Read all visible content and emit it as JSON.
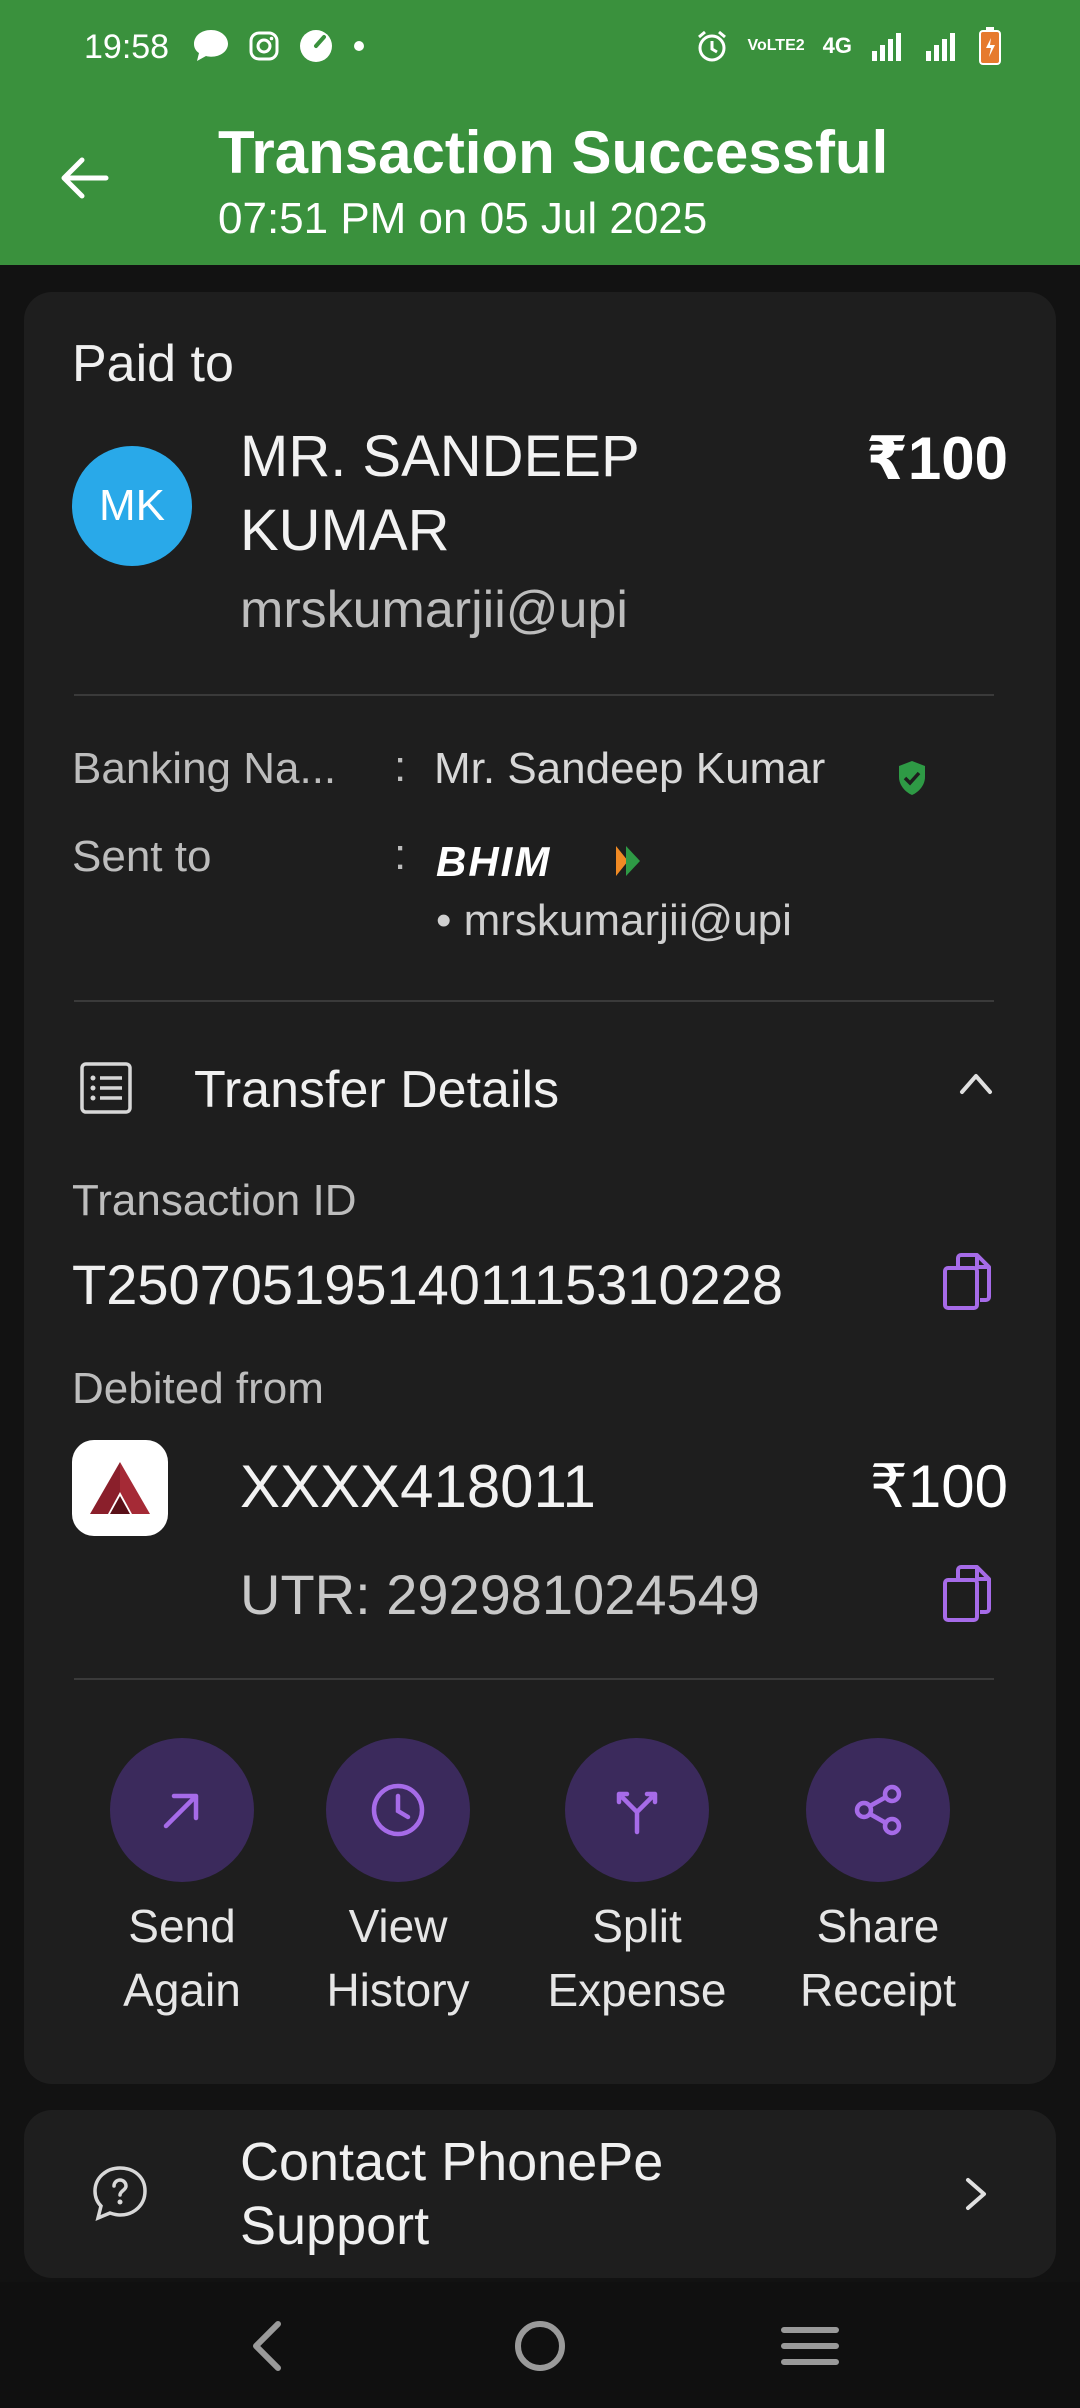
{
  "status_bar": {
    "time": "19:58",
    "network_label": "4G",
    "volte_label": "VoLTE2"
  },
  "header": {
    "title": "Transaction Successful",
    "subtitle": "07:51 PM on 05 Jul 2025"
  },
  "payee": {
    "section_label": "Paid to",
    "avatar_initials": "MK",
    "name": "MR. SANDEEP KUMAR",
    "amount": "₹100",
    "vpa": "mrskumarjii@upi"
  },
  "banking": {
    "banking_name_label": "Banking Na...",
    "banking_name_value": "Mr. Sandeep  Kumar",
    "sent_to_label": "Sent to",
    "sent_to_app": "BHIM",
    "sent_to_vpa": "• mrskumarjii@upi",
    "colon": ":"
  },
  "transfer": {
    "title": "Transfer Details",
    "txn_id_label": "Transaction ID",
    "txn_id": "T2507051951401115310228",
    "debited_label": "Debited from",
    "account": "XXXX418011",
    "account_amount": "₹100",
    "utr": "UTR: 292981024549"
  },
  "actions": [
    {
      "label": "Send Again",
      "icon": "arrow-up-right-icon"
    },
    {
      "label": "View History",
      "icon": "clock-icon"
    },
    {
      "label": "Split Expense",
      "icon": "split-icon"
    },
    {
      "label": "Share Receipt",
      "icon": "share-icon"
    }
  ],
  "support": {
    "label": "Contact PhonePe Support"
  },
  "colors": {
    "header_bg": "#3a913d",
    "card_bg": "#1e1e1e",
    "accent_purple": "#a66be8",
    "action_circle": "#3b2a5c",
    "avatar_bg": "#29a9e9",
    "verified_green": "#2e9a45"
  }
}
